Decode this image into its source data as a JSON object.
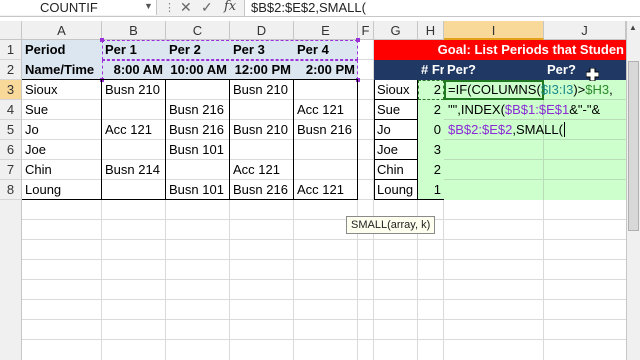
{
  "formula_bar": {
    "name_box": "COUNTIF",
    "formula": "$B$2:$E$2,SMALL("
  },
  "columns": [
    "A",
    "B",
    "C",
    "D",
    "E",
    "F",
    "G",
    "H",
    "I",
    "J"
  ],
  "rows": [
    "1",
    "2",
    "3",
    "4",
    "5",
    "6",
    "7",
    "8"
  ],
  "table": {
    "header_row1": [
      "Period",
      "Per 1",
      "Per 2",
      "Per 3",
      "Per 4"
    ],
    "header_row2": [
      "Name/Time",
      "8:00 AM",
      "10:00 AM",
      "12:00 PM",
      "2:00 PM"
    ],
    "data": [
      [
        "Sioux",
        "Busn 210",
        "",
        "Busn 210",
        ""
      ],
      [
        "Sue",
        "",
        "Busn 216",
        "",
        "Acc 121"
      ],
      [
        "Jo",
        "Acc 121",
        "Busn 216",
        "Busn 210",
        "Busn 216"
      ],
      [
        "Joe",
        "",
        "Busn 101",
        "",
        ""
      ],
      [
        "Chin",
        "Busn 214",
        "",
        "Acc 121",
        ""
      ],
      [
        "Loung",
        "",
        "Busn 101",
        "Busn 216",
        "Acc 121"
      ]
    ]
  },
  "right_table": {
    "goal": "Goal: List Periods that Studen",
    "h_header": "# Fr",
    "i_header": "Per?",
    "j_header": "Per?",
    "names": [
      "Sioux",
      "Sue",
      "Jo",
      "Joe",
      "Chin",
      "Loung"
    ],
    "counts": [
      "2",
      "2",
      "0",
      "3",
      "2",
      "1"
    ]
  },
  "editing_formula": {
    "line1_a": "=IF(COLUMNS(",
    "line1_b": "$I3:I3",
    "line1_c": ")>",
    "line1_d": "$H3",
    "line1_e": ",",
    "line2_a": "\"\",INDEX(",
    "line2_b": "$B$1:$E$1",
    "line2_c": "&\"-\"&",
    "line3_a": "$B$2:$E$2",
    "line3_b": ",SMALL("
  },
  "tooltip": "SMALL(array, k)",
  "colors": {
    "goal_bg": "#ff0000",
    "header_bg": "#dce6f1",
    "edit_bg": "#ccffcc",
    "navy": "#1f3864",
    "selected_header": "#f9d99a"
  }
}
